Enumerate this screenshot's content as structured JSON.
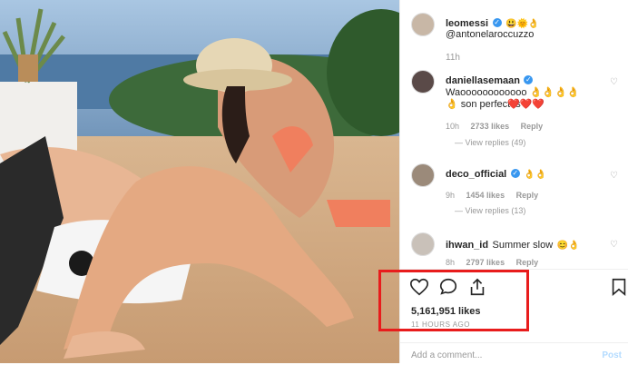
{
  "post": {
    "author": "leomessi",
    "caption_mention": "@antonelaroccuzzo",
    "caption_emoji": "😃🌞👌",
    "time": "11h"
  },
  "comments": [
    {
      "user": "daniellasemaan",
      "text": "Waoooooooooooo 👌👌👌👌👌 son perfectos",
      "hearts": "❤️❤️❤️",
      "time": "10h",
      "likes": "2733 likes",
      "reply": "Reply",
      "view_replies": "View replies (49)"
    },
    {
      "user": "deco_official",
      "emoji": "👌👌",
      "time": "9h",
      "likes": "1454 likes",
      "reply": "Reply",
      "view_replies": "View replies (13)"
    },
    {
      "user": "ihwan_id",
      "text": "Summer slow",
      "emoji": "😊👌",
      "time": "8h",
      "likes": "2797 likes",
      "reply": "Reply"
    }
  ],
  "actions": {
    "likes": "5,161,951 likes",
    "ago": "11 HOURS AGO",
    "add_comment_placeholder": "Add a comment...",
    "post_label": "Post"
  },
  "colors": {
    "highlight": "#e81c1c",
    "verified": "#3897f0",
    "heart_red": "#e0245e"
  }
}
